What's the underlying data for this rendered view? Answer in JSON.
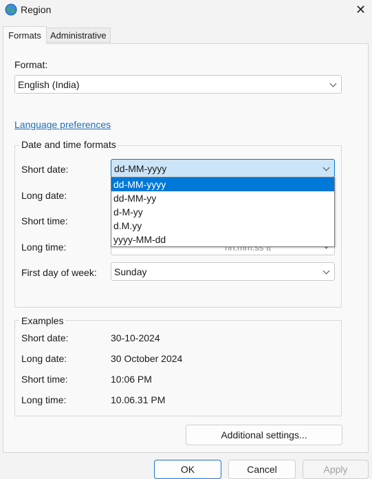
{
  "window": {
    "title": "Region",
    "icon": "globe-icon"
  },
  "tabs": [
    {
      "label": "Formats"
    },
    {
      "label": "Administrative"
    }
  ],
  "format": {
    "label": "Format:",
    "value": "English (India)"
  },
  "language_link": "Language preferences",
  "date_time_formats": {
    "title": "Date and time formats",
    "short_date": {
      "label": "Short date:",
      "value": "dd-MM-yyyy"
    },
    "long_date": {
      "label": "Long date:"
    },
    "short_time": {
      "label": "Short time:"
    },
    "long_time": {
      "label": "Long time:",
      "partial_value": "hh.mm.ss tt"
    },
    "first_day": {
      "label": "First day of week:",
      "value": "Sunday"
    },
    "dropdown_options": [
      "dd-MM-yyyy",
      "dd-MM-yy",
      "d-M-yy",
      "d.M.yy",
      "yyyy-MM-dd"
    ]
  },
  "examples": {
    "title": "Examples",
    "rows": [
      {
        "label": "Short date:",
        "value": "30-10-2024"
      },
      {
        "label": "Long date:",
        "value": "30 October 2024"
      },
      {
        "label": "Short time:",
        "value": "10:06 PM"
      },
      {
        "label": "Long time:",
        "value": "10.06.31 PM"
      }
    ]
  },
  "buttons": {
    "additional_settings": "Additional settings...",
    "ok": "OK",
    "cancel": "Cancel",
    "apply": "Apply"
  },
  "colors": {
    "accent": "#0078d7",
    "link": "#1f6fb8"
  }
}
